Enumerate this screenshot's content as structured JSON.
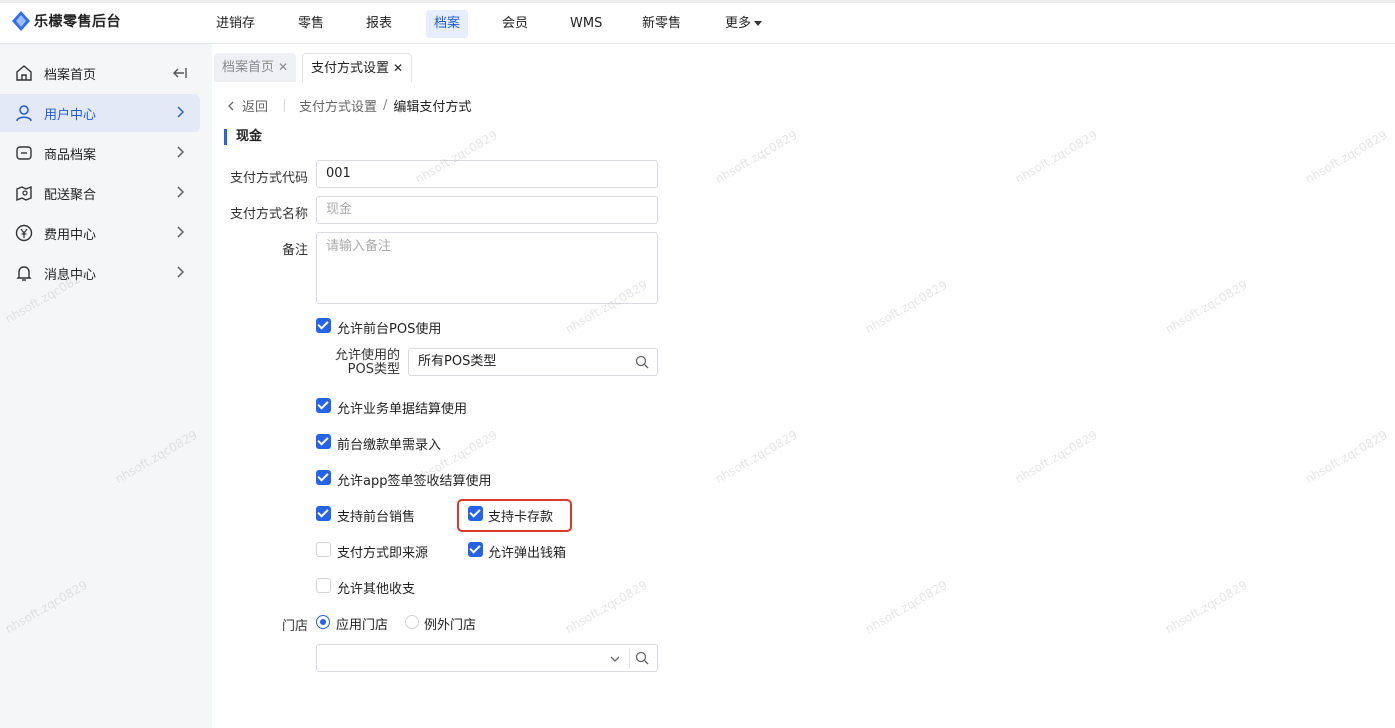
{
  "app": {
    "title": "乐檬零售后台"
  },
  "topnav": {
    "items": [
      "进销存",
      "零售",
      "报表",
      "档案",
      "会员",
      "WMS",
      "新零售",
      "更多"
    ],
    "active": "档案"
  },
  "sidebar": {
    "items": [
      {
        "label": "档案首页",
        "icon": "home-icon"
      },
      {
        "label": "用户中心",
        "icon": "user-icon"
      },
      {
        "label": "商品档案",
        "icon": "product-icon"
      },
      {
        "label": "配送聚合",
        "icon": "delivery-icon"
      },
      {
        "label": "费用中心",
        "icon": "yen-icon"
      },
      {
        "label": "消息中心",
        "icon": "bell-icon"
      }
    ],
    "active": "用户中心"
  },
  "tabs": [
    {
      "label": "档案首页"
    },
    {
      "label": "支付方式设置"
    }
  ],
  "breadcrumb": {
    "back": "返回",
    "parent": "支付方式设置",
    "separator": "/",
    "current": "编辑支付方式"
  },
  "section": {
    "title": "现金"
  },
  "form": {
    "code_label": "支付方式代码",
    "code_value": "001",
    "name_label": "支付方式名称",
    "name_placeholder": "现金",
    "remark_label": "备注",
    "remark_placeholder": "请输入备注",
    "pos_type_label_1": "允许使用的",
    "pos_type_label_2": "POS类型",
    "pos_type_value": "所有POS类型",
    "store_label": "门店"
  },
  "checkboxes": {
    "allow_pos": {
      "label": "允许前台POS使用",
      "checked": true
    },
    "allow_business": {
      "label": "允许业务单据结算使用",
      "checked": true
    },
    "front_payment": {
      "label": "前台缴款单需录入",
      "checked": true
    },
    "allow_app": {
      "label": "允许app签单签收结算使用",
      "checked": true
    },
    "front_sales": {
      "label": "支持前台销售",
      "checked": true
    },
    "card_deposit": {
      "label": "支持卡存款",
      "checked": true
    },
    "is_source": {
      "label": "支付方式即来源",
      "checked": false
    },
    "cash_drawer": {
      "label": "允许弹出钱箱",
      "checked": true
    },
    "other_income": {
      "label": "允许其他收支",
      "checked": false
    }
  },
  "radios": {
    "apply_store": {
      "label": "应用门店",
      "checked": true
    },
    "exclude_store": {
      "label": "例外门店",
      "checked": false
    }
  },
  "watermark": "nhsoft.zqc0829",
  "colors": {
    "accent": "#2563eb",
    "highlight": "#d9382a"
  }
}
